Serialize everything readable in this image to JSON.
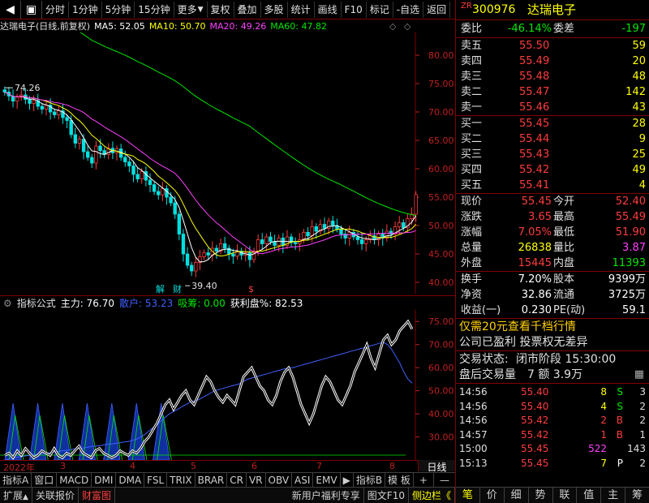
{
  "toolbar": {
    "items": [
      "分时",
      "1分钟",
      "5分钟",
      "15分钟",
      "更多",
      "复权",
      "叠加",
      "多股",
      "统计",
      "画线",
      "F10",
      "标记",
      "-自选",
      "返回"
    ]
  },
  "chart_head": {
    "title": "达瑞电子(日线,前复权)",
    "ma5": "MA5: 52.05",
    "ma10": "MA10: 50.70",
    "ma20": "MA20: 49.26",
    "ma60": "MA60: 47.82",
    "colors": {
      "ma5": "#ffffff",
      "ma10": "#ffff00",
      "ma20": "#ff40ff",
      "ma60": "#00e600"
    }
  },
  "annotations": {
    "high_label": "74.26",
    "low_label": "39.40",
    "tag1": "解",
    "tag2": "财",
    "tag3": "$"
  },
  "ind_head": {
    "title": "指标公式",
    "main": "主力: 76.70",
    "retail": "散户: 53.23",
    "absorb": "吸筹: 0.00",
    "profit": "获利盘%: 82.53"
  },
  "date_axis": {
    "labels": [
      "2022年",
      "3",
      "4",
      "5",
      "6",
      "7",
      "8"
    ],
    "period": "日线"
  },
  "ind_tabs": [
    "指标A",
    "窗口",
    "MACD",
    "DMI",
    "DMA",
    "FSL",
    "TRIX",
    "BRAR",
    "CR",
    "VR",
    "OBV",
    "ASI",
    "EMV",
    "指标B",
    "模 板",
    "+",
    "—"
  ],
  "bottom_bar": {
    "left": [
      "扩展",
      "关联报价",
      "财富图"
    ],
    "right": [
      "新用户福利专享",
      "图文F10",
      "侧边栏《"
    ]
  },
  "chart_data": [
    {
      "type": "candlestick",
      "title": "达瑞电子(日线,前复权)",
      "ylim": [
        38,
        84
      ],
      "yticks": [
        40,
        45,
        50,
        55,
        60,
        65,
        70,
        75,
        80
      ],
      "ytick_labels": [
        "40.00",
        "45.00",
        "50.00",
        "55.00",
        "60.00",
        "65.00",
        "70.00",
        "75.00",
        "80.00"
      ],
      "x_labels": [
        "2022年",
        "3",
        "4",
        "5",
        "6",
        "7",
        "8"
      ],
      "close": [
        73.5,
        72.8,
        71.9,
        72.6,
        73.0,
        72.2,
        71.5,
        72.0,
        71.0,
        70.5,
        71.2,
        70.0,
        69.5,
        70.2,
        69.0,
        68.5,
        66.0,
        64.5,
        65.2,
        63.0,
        62.0,
        61.0,
        64.0,
        63.2,
        62.5,
        63.6,
        62.8,
        63.5,
        62.0,
        61.2,
        60.5,
        59.0,
        58.2,
        59.5,
        58.0,
        57.2,
        56.0,
        55.4,
        56.5,
        55.0,
        54.0,
        52.0,
        48.5,
        45.0,
        43.0,
        42.0,
        43.5,
        44.5,
        45.2,
        44.8,
        46.0,
        45.5,
        46.8,
        46.0,
        45.0,
        44.6,
        45.5,
        44.8,
        45.2,
        44.0,
        45.5,
        47.5,
        46.8,
        48.0,
        47.2,
        46.5,
        47.8,
        46.5,
        48.0,
        47.0,
        46.8,
        47.5,
        48.8,
        48.2,
        49.8,
        49.0,
        50.2,
        49.5,
        50.8,
        50.0,
        49.4,
        48.5,
        47.8,
        48.8,
        48.0,
        47.5,
        46.8,
        47.5,
        48.2,
        47.5,
        48.5,
        47.8,
        49.0,
        48.5,
        49.8,
        50.5,
        49.6,
        51.2,
        52.0,
        55.45
      ],
      "series": [
        {
          "name": "MA5",
          "color": "#ffffff",
          "last": 52.05
        },
        {
          "name": "MA10",
          "color": "#ffff00",
          "last": 50.7
        },
        {
          "name": "MA20",
          "color": "#ff40ff",
          "last": 49.26
        },
        {
          "name": "MA60",
          "color": "#00e600",
          "last": 47.82
        }
      ]
    },
    {
      "type": "line",
      "title": "指标公式",
      "ylim": [
        20,
        85
      ],
      "yticks": [
        30,
        40,
        50,
        60,
        70,
        80
      ],
      "ytick_labels": [
        "30.00",
        "40.00",
        "50.00",
        "60.00",
        "70.00",
        "75.00"
      ],
      "series": [
        {
          "name": "主力",
          "color": "#ffffff",
          "values": [
            22,
            23,
            21,
            24,
            22,
            25,
            23,
            21,
            22,
            24,
            23,
            22,
            25,
            22,
            21,
            23,
            22,
            24,
            26,
            23,
            22,
            21,
            24,
            25,
            23,
            22,
            21,
            22,
            24,
            23,
            22,
            24,
            23,
            25,
            28,
            30,
            33,
            36,
            40,
            44,
            46,
            42,
            45,
            48,
            50,
            46,
            44,
            48,
            52,
            56,
            54,
            50,
            47,
            45,
            48,
            46,
            44,
            50,
            56,
            58,
            60,
            56,
            52,
            50,
            46,
            44,
            48,
            54,
            58,
            60,
            56,
            50,
            44,
            40,
            36,
            40,
            46,
            52,
            56,
            54,
            50,
            46,
            44,
            48,
            52,
            58,
            62,
            66,
            70,
            64,
            60,
            66,
            72,
            74,
            70,
            72,
            76,
            78,
            80,
            76.7
          ]
        },
        {
          "name": "散户",
          "color": "#4060ff",
          "values": [
            20,
            20.5,
            21,
            21.2,
            21.5,
            21.8,
            22,
            22.2,
            22.5,
            22.8,
            23,
            23.2,
            23.5,
            23.7,
            24,
            24.2,
            24.5,
            24.8,
            25,
            25.2,
            25.5,
            25.8,
            26,
            26.2,
            26.5,
            26.8,
            27,
            27.2,
            27.5,
            27.8,
            28,
            28.5,
            29,
            30,
            31,
            32.5,
            34,
            35.5,
            37,
            38.5,
            40,
            41,
            42,
            43,
            44,
            45,
            45.5,
            46,
            47,
            48,
            49,
            50,
            50.5,
            51,
            51.5,
            52,
            52.5,
            53,
            54,
            55,
            55.5,
            56,
            56.5,
            57,
            57.5,
            58,
            58.5,
            59,
            59.5,
            60,
            60,
            60.5,
            61,
            61.5,
            62,
            62.5,
            63,
            63.5,
            64,
            64.5,
            65,
            65.5,
            66,
            66.5,
            67,
            67.5,
            68,
            68.5,
            69,
            69.5,
            70,
            70.5,
            71,
            70,
            68,
            65,
            62,
            58,
            55,
            53.23
          ]
        },
        {
          "name": "吸筹",
          "color": "#00e600",
          "last": 0.0
        },
        {
          "name": "获利盘%",
          "color": "#ffffff",
          "last": 82.53
        }
      ]
    }
  ],
  "panel": {
    "code": "300976",
    "name": "达瑞电子",
    "zr": "ZR",
    "wb_label": "委比",
    "wb_value": "-46.14%",
    "wc_label": "委差",
    "wc_value": "-197",
    "asks": [
      {
        "label": "卖五",
        "price": "55.50",
        "vol": "59"
      },
      {
        "label": "卖四",
        "price": "55.49",
        "vol": "20"
      },
      {
        "label": "卖三",
        "price": "55.48",
        "vol": "48"
      },
      {
        "label": "卖二",
        "price": "55.47",
        "vol": "142"
      },
      {
        "label": "卖一",
        "price": "55.46",
        "vol": "43"
      }
    ],
    "bids": [
      {
        "label": "买一",
        "price": "55.45",
        "vol": "28"
      },
      {
        "label": "买二",
        "price": "55.44",
        "vol": "9"
      },
      {
        "label": "买三",
        "price": "55.43",
        "vol": "25"
      },
      {
        "label": "买四",
        "price": "55.42",
        "vol": "49"
      },
      {
        "label": "买五",
        "price": "55.41",
        "vol": "4"
      }
    ],
    "stats": [
      {
        "l1": "现价",
        "v1": "55.45",
        "c1": "red",
        "l2": "今开",
        "v2": "52.40",
        "c2": "red"
      },
      {
        "l1": "涨跌",
        "v1": "3.65",
        "c1": "red",
        "l2": "最高",
        "v2": "55.49",
        "c2": "red"
      },
      {
        "l1": "涨幅",
        "v1": "7.05%",
        "c1": "red",
        "l2": "最低",
        "v2": "51.90",
        "c2": "red"
      },
      {
        "l1": "总量",
        "v1": "26838",
        "c1": "yellow",
        "l2": "量比",
        "v2": "3.87",
        "c2": "magenta"
      },
      {
        "l1": "外盘",
        "v1": "15445",
        "c1": "red",
        "l2": "内盘",
        "v2": "11393",
        "c2": "green"
      }
    ],
    "stats2": [
      {
        "l1": "换手",
        "v1": "7.20%",
        "l2": "股本",
        "v2": "9399万"
      },
      {
        "l1": "净资",
        "v1": "32.86",
        "l2": "流通",
        "v2": "3725万"
      },
      {
        "l1": "收益(一)",
        "v1": "0.230",
        "l2": "PE(动)",
        "v2": "59.1"
      }
    ],
    "promo": "仅需20元查看千档行情",
    "info1": "公司已盈利 投票权无差异",
    "status_label": "交易状态:",
    "status_value": "闭市阶段 15:30:00",
    "after_label": "盘后交易量",
    "after_value": "7 额 3.9万",
    "trades": [
      {
        "t": "14:56",
        "p": "55.40",
        "v": "8",
        "s": "S",
        "n": "3",
        "vc": "yellow",
        "sc": "green"
      },
      {
        "t": "14:56",
        "p": "55.40",
        "v": "4",
        "s": "S",
        "n": "2",
        "vc": "yellow",
        "sc": "green"
      },
      {
        "t": "14:56",
        "p": "55.42",
        "v": "2",
        "s": "B",
        "n": "2",
        "vc": "red",
        "sc": "red"
      },
      {
        "t": "14:57",
        "p": "55.42",
        "v": "1",
        "s": "B",
        "n": "1",
        "vc": "red",
        "sc": "red"
      },
      {
        "t": "15:00",
        "p": "55.45",
        "v": "522",
        "s": "",
        "n": "143",
        "vc": "magenta",
        "sc": "white"
      },
      {
        "t": "15:13",
        "p": "55.45",
        "v": "7",
        "s": "P",
        "n": "2",
        "vc": "yellow",
        "sc": "white"
      }
    ],
    "tabs": [
      "笔",
      "价",
      "细",
      "势",
      "联",
      "值",
      "主",
      "筹"
    ]
  }
}
